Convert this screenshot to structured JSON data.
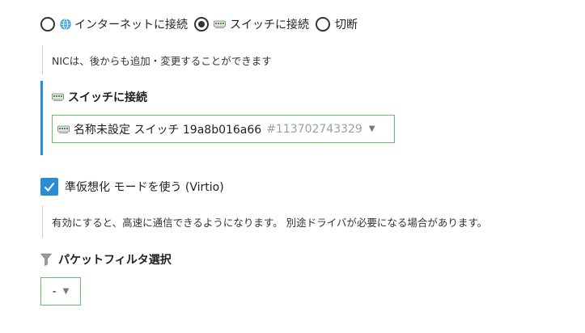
{
  "connection": {
    "options": [
      {
        "label": "インターネットに接続",
        "icon": "globe-icon",
        "checked": false
      },
      {
        "label": "スイッチに接続",
        "icon": "switch-icon",
        "checked": true
      },
      {
        "label": "切断",
        "icon": "",
        "checked": false
      }
    ],
    "note": "NICは、後からも追加・変更することができます"
  },
  "switch_section": {
    "title": "スイッチに接続",
    "selected_name": "名称未設定 スイッチ 19a8b016a66",
    "selected_id": "#113702743329"
  },
  "virtio": {
    "label": "準仮想化 モードを使う (Virtio)",
    "checked": true,
    "note": "有効にすると、高速に通信できるようになります。 別途ドライバが必要になる場合があります。"
  },
  "packet_filter": {
    "title": "パケットフィルタ選択",
    "value": "-"
  },
  "colors": {
    "accent": "#2a8dd4",
    "select_border": "#6dbb6d"
  }
}
